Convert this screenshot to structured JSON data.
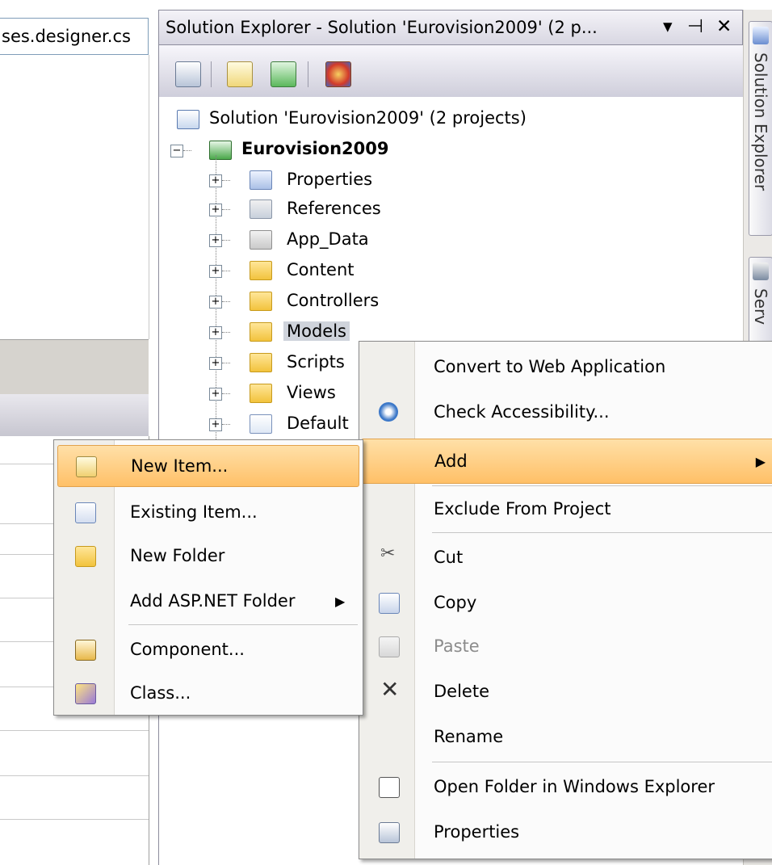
{
  "editor": {
    "tab_label": "ses.designer.cs"
  },
  "solution_explorer": {
    "title": "Solution Explorer - Solution 'Eurovision2009' (2 p...",
    "controls": {
      "dropdown": "▾",
      "pin": "⊣",
      "close": "✕"
    },
    "toolbar_icons": [
      "properties-icon",
      "show-all-files-icon",
      "refresh-icon",
      "class-diagram-icon"
    ],
    "tree": {
      "solution": "Solution 'Eurovision2009' (2 projects)",
      "project": "Eurovision2009",
      "items": [
        {
          "label": "Properties",
          "icon": "properties-folder-icon"
        },
        {
          "label": "References",
          "icon": "references-icon"
        },
        {
          "label": "App_Data",
          "icon": "app-data-folder-icon"
        },
        {
          "label": "Content",
          "icon": "folder-icon"
        },
        {
          "label": "Controllers",
          "icon": "folder-icon"
        },
        {
          "label": "Models",
          "icon": "folder-icon"
        },
        {
          "label": "Scripts",
          "icon": "folder-icon"
        },
        {
          "label": "Views",
          "icon": "folder-icon"
        },
        {
          "label": "Default",
          "icon": "web-page-icon"
        }
      ]
    }
  },
  "side_tabs": {
    "solution_explorer": "Solution Explorer",
    "server_explorer": "Serv"
  },
  "context_menu": {
    "items": [
      {
        "label": "Convert to Web Application"
      },
      {
        "label": "Check Accessibility..."
      },
      {
        "label": "Add"
      },
      {
        "label": "Exclude From Project"
      },
      {
        "label": "Cut"
      },
      {
        "label": "Copy"
      },
      {
        "label": "Paste"
      },
      {
        "label": "Delete"
      },
      {
        "label": "Rename"
      },
      {
        "label": "Open Folder in Windows Explorer"
      },
      {
        "label": "Properties"
      }
    ],
    "submenu_arrow": "▶"
  },
  "add_submenu": {
    "items": [
      {
        "label": "New Item..."
      },
      {
        "label": "Existing Item..."
      },
      {
        "label": "New Folder"
      },
      {
        "label": "Add ASP.NET Folder"
      },
      {
        "label": "Component..."
      },
      {
        "label": "Class..."
      }
    ],
    "submenu_arrow": "▶"
  },
  "colors": {
    "highlight": "#ffc067",
    "menu_gutter": "#f0efeb",
    "folder": "#f2c33d"
  }
}
